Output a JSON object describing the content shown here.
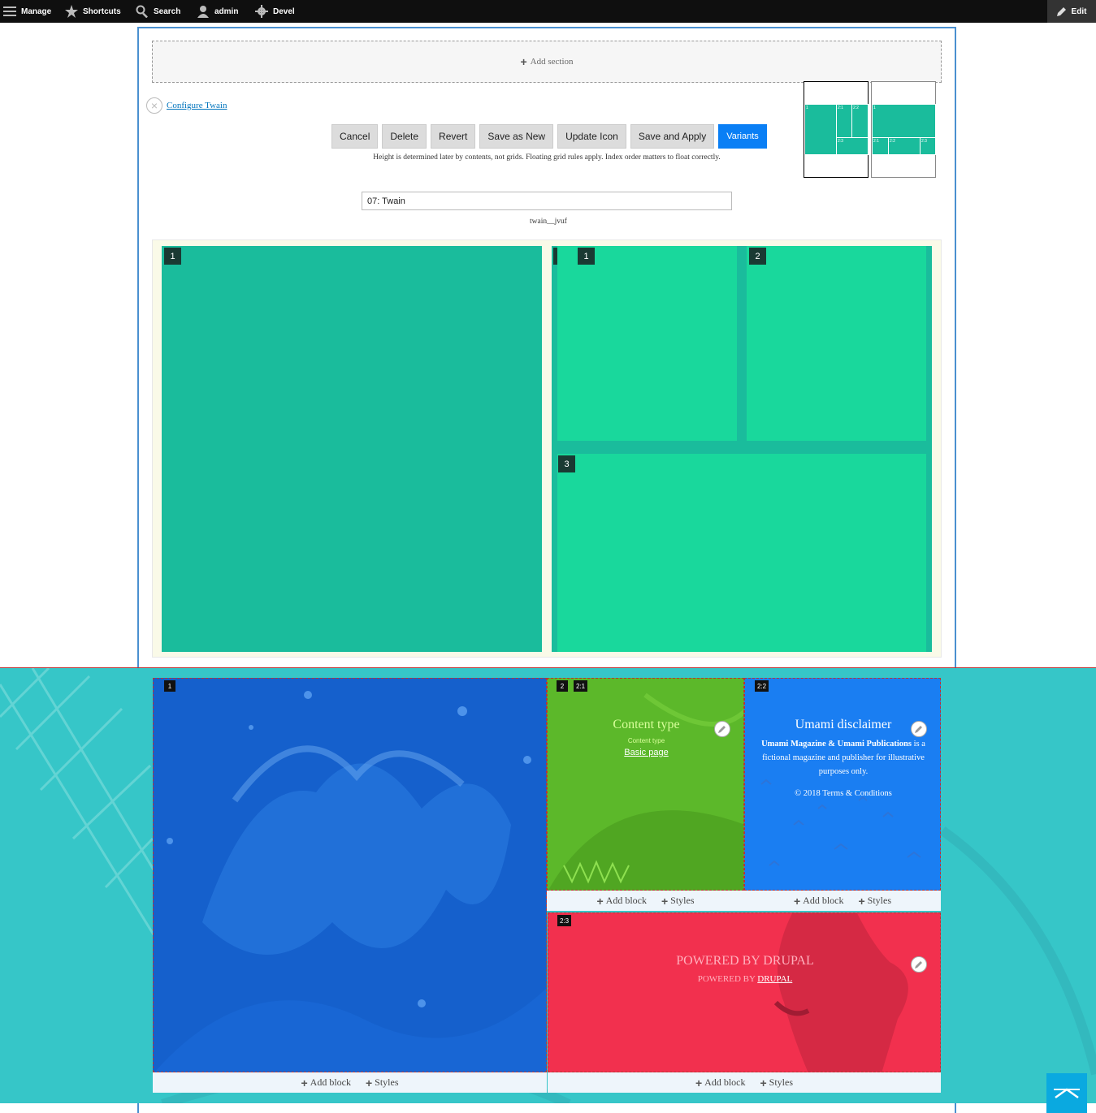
{
  "toolbar": {
    "manage": "Manage",
    "shortcuts": "Shortcuts",
    "search": "Search",
    "user": "admin",
    "devel": "Devel",
    "edit": "Edit"
  },
  "add_section": "Add section",
  "configure_link": "Configure Twain",
  "buttons": {
    "cancel": "Cancel",
    "delete": "Delete",
    "revert": "Revert",
    "save_new": "Save as New",
    "update_icon": "Update Icon",
    "save_apply": "Save and Apply",
    "variants": "Variants"
  },
  "help_text": "Height is determined later by contents, not grids. Floating grid rules apply. Index order matters to float correctly.",
  "layout_name": "07: Twain",
  "machine_name": "twain__jvuf",
  "thumbs": {
    "a": [
      "1",
      "2:1",
      "2:2",
      "2:3"
    ],
    "b": [
      "1",
      "2:1",
      "2:2",
      "2:3"
    ]
  },
  "grid_labels": {
    "r1": "1",
    "r2": "2",
    "r2_1": "1",
    "r2_2": "2",
    "r2_3": "3"
  },
  "colors": {
    "region_dark": "#1abc9c",
    "region_light": "#19d89c",
    "accent": "#0a7ff5"
  },
  "preview": {
    "tag_1": "1",
    "tag_2": "2",
    "tag_21": "2:1",
    "tag_22": "2:2",
    "tag_23": "2:3",
    "content_type_title": "Content type",
    "content_type_label": "Content type",
    "content_type_value": "Basic page",
    "disclaimer_title": "Umami disclaimer",
    "disclaimer_bold": "Umami Magazine & Umami Publications",
    "disclaimer_rest": " is a fictional magazine and publisher for illustrative purposes only.",
    "disclaimer_copyright": "© 2018 Terms & Conditions",
    "powered_title": "POWERED BY DRUPAL",
    "powered_sub_prefix": "POWERED BY ",
    "powered_sub_link": "DRUPAL",
    "add_block": "Add block",
    "styles": "Styles"
  }
}
